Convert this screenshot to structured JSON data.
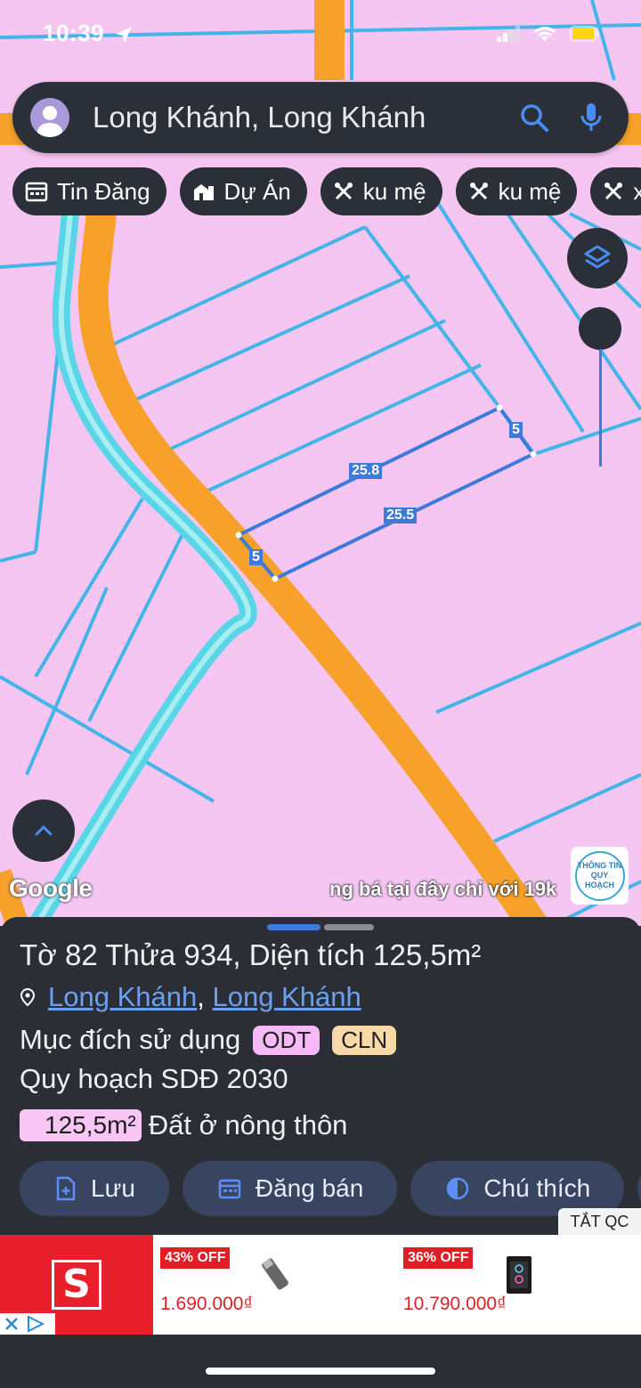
{
  "status_bar": {
    "time": "10:39"
  },
  "search": {
    "query": "Long Khánh, Long Khánh"
  },
  "chips": [
    {
      "label": "Tin Đăng",
      "icon": "calendar-icon"
    },
    {
      "label": "Dự Án",
      "icon": "building-icon"
    },
    {
      "label": "ku mệ",
      "icon": "tools-icon"
    },
    {
      "label": "ku mệ",
      "icon": "tools-icon"
    },
    {
      "label": "x",
      "icon": "tools-icon"
    }
  ],
  "map": {
    "parcel_dimensions": [
      "5",
      "25.8",
      "25.5",
      "5"
    ],
    "google_logo": "Google",
    "ad_banner_text": "ng bá tại đây chỉ với 19k",
    "planning_logo": {
      "line1": "THÔNG TIN",
      "line2": "QUY HOẠCH"
    },
    "land_color": "#f6c6f3",
    "road_color": "#f7a02a",
    "boundary_color": "#45b5e8",
    "selection_color": "#3d7ad9"
  },
  "sheet": {
    "title": "Tờ 82 Thửa 934, Diện tích 125,5m²",
    "location": {
      "ward": "Long Khánh",
      "separator": ",",
      "city": "Long Khánh"
    },
    "purpose": {
      "label": "Mục đích sử dụng",
      "tags": [
        "ODT",
        "CLN"
      ]
    },
    "planning_label": "Quy hoạch SDĐ 2030",
    "land_use": {
      "area": "125,5m²",
      "type": "Đất ở nông thôn"
    },
    "actions": [
      {
        "label": "Lưu",
        "icon": "save-icon"
      },
      {
        "label": "Đăng bán",
        "icon": "calendar-icon"
      },
      {
        "label": "Chú thích",
        "icon": "legend-icon"
      }
    ]
  },
  "ad": {
    "close_label": "TẮT QC",
    "products": [
      {
        "discount": "43% OFF",
        "price": "1.690.000₫"
      },
      {
        "discount": "36% OFF",
        "price": "10.790.000₫"
      }
    ]
  }
}
